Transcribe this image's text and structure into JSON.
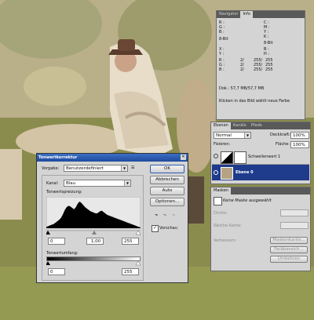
{
  "info_panel": {
    "tabs": [
      "Navigator",
      "Info"
    ],
    "rgb1": {
      "labels": [
        "R :",
        "G :",
        "B :"
      ]
    },
    "cmyk1": {
      "labels": [
        "C :",
        "M :",
        "Y :",
        "K :"
      ]
    },
    "bit_left": "8-Bit",
    "bit_right": "8-Bit",
    "xy_labels": [
      "X :",
      "Y :"
    ],
    "wh_labels": [
      "B :",
      "H :"
    ],
    "rgb2": {
      "labels": [
        "R :",
        "G :",
        "B :"
      ],
      "values_a": [
        "2/",
        "2/",
        "2/"
      ],
      "values_b": [
        "255/",
        "255/",
        "255/"
      ],
      "values_c": [
        "255",
        "255",
        "255"
      ]
    },
    "doc": "Dok.: 57,7 MB/57,7 MB",
    "hint": "Klicken in das Bild wählt neue Farbe"
  },
  "layers_panel": {
    "tabs": [
      "Ebenen",
      "Kanäle",
      "Pfade"
    ],
    "blend_mode": "Normal",
    "opacity_label": "Deckkraft:",
    "opacity_value": "100%",
    "fix_label": "Fixieren:",
    "fill_label": "Fläche:",
    "fill_value": "100%",
    "layers": [
      {
        "name": "Schwellenwert 1",
        "selected": false
      },
      {
        "name": "Ebene 0",
        "selected": true
      }
    ]
  },
  "masks_panel": {
    "tab": "Masken",
    "no_mask": "Keine Maske ausgewählt",
    "density_label": "Dichte:",
    "feather_label": "Weiche Kante:",
    "refine_label": "Verbessern:",
    "buttons": [
      "Maskenkante...",
      "Farbbereich...",
      "Umkehren"
    ]
  },
  "levels_dialog": {
    "title": "Tonwertkorrektur",
    "preset_label": "Vorgabe:",
    "preset_value": "Benutzerdefiniert",
    "channel_label": "Kanal:",
    "channel_value": "Blau",
    "input_label": "Tonwertspreizung:",
    "input_values": [
      "0",
      "1,00",
      "255"
    ],
    "output_label": "Tonwertumfang:",
    "output_values": [
      "0",
      "255"
    ],
    "buttons": {
      "ok": "OK",
      "cancel": "Abbrechen",
      "auto": "Auto",
      "options": "Optionen..."
    },
    "preview_label": "Vorschau",
    "preview_checked": true,
    "histogram": [
      2,
      3,
      4,
      5,
      6,
      8,
      10,
      12,
      15,
      20,
      26,
      30,
      32,
      31,
      29,
      27,
      30,
      35,
      38,
      36,
      33,
      30,
      28,
      26,
      24,
      23,
      22,
      21,
      22,
      24,
      25,
      23,
      21,
      19,
      18,
      17,
      16,
      15,
      14,
      13,
      12,
      11,
      10,
      9,
      8,
      7,
      6,
      5,
      4,
      3,
      2,
      1
    ]
  }
}
